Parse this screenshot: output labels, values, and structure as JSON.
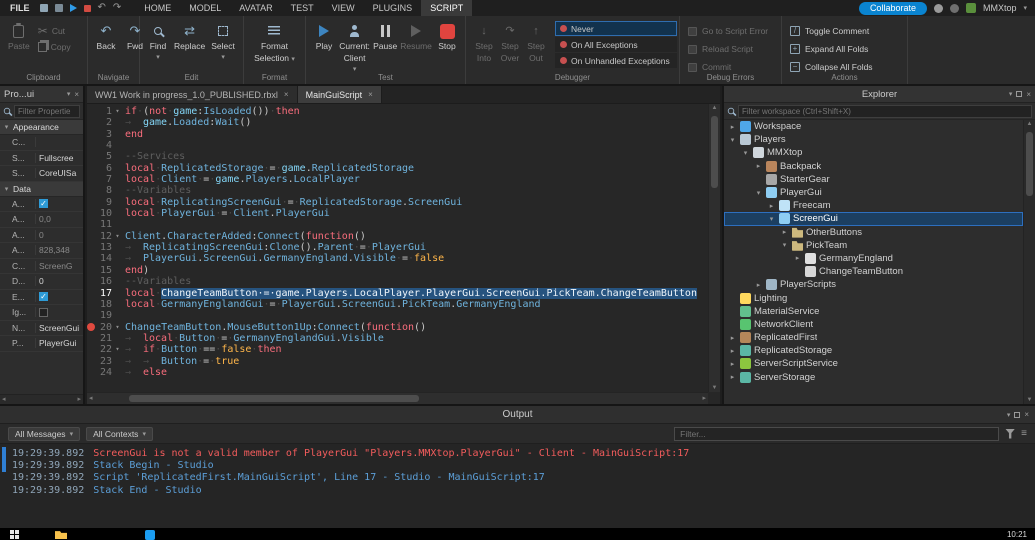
{
  "menubar": {
    "file_label": "FILE",
    "tabs": [
      "HOME",
      "MODEL",
      "AVATAR",
      "TEST",
      "VIEW",
      "PLUGINS",
      "SCRIPT"
    ],
    "active_tab": "SCRIPT",
    "collaborate_label": "Collaborate",
    "username": "MMXtop"
  },
  "ribbon": {
    "clipboard": {
      "label": "Clipboard",
      "paste": "Paste",
      "cut": "Cut",
      "copy": "Copy"
    },
    "navigate": {
      "label": "Navigate",
      "back": "Back",
      "fwd": "Fwd"
    },
    "edit": {
      "label": "Edit",
      "find": "Find",
      "replace": "Replace",
      "select": "Select"
    },
    "format": {
      "label": "Format",
      "line1": "Format",
      "line2": "Selection"
    },
    "test": {
      "label": "Test",
      "play": "Play",
      "current1": "Current:",
      "current2": "Client",
      "pause": "Pause",
      "resume": "Resume",
      "stop": "Stop"
    },
    "debugger": {
      "label": "Debugger",
      "steps": [
        [
          "Step",
          "Into"
        ],
        [
          "Step",
          "Over"
        ],
        [
          "Step",
          "Out"
        ]
      ],
      "step_icons": [
        "↓",
        "↷",
        "↑"
      ],
      "exceptions": [
        "Never",
        "On All Exceptions",
        "On Unhandled Exceptions"
      ],
      "selected_exception": "Never"
    },
    "debug_errors": {
      "label": "Debug Errors",
      "items": [
        "Go to Script Error",
        "Reload Script",
        "Commit"
      ]
    },
    "actions": {
      "label": "Actions",
      "items": [
        "Toggle Comment",
        "Expand All Folds",
        "Collapse All Folds"
      ],
      "icons": [
        "/",
        "+",
        "−"
      ]
    }
  },
  "properties": {
    "title": "Pro...ui",
    "filter_placeholder": "Filter Propertie",
    "sections": [
      {
        "name": "Appearance",
        "rows": [
          {
            "key": "C...",
            "value": ""
          },
          {
            "key": "S...",
            "value": "Fullscree"
          },
          {
            "key": "S...",
            "value": "CoreUISa"
          }
        ]
      },
      {
        "name": "Data",
        "rows": [
          {
            "key": "A...",
            "checkbox": true,
            "checked": true
          },
          {
            "key": "A...",
            "value": "0,0",
            "dim": true
          },
          {
            "key": "A...",
            "value": "0",
            "dim": true
          },
          {
            "key": "A...",
            "value": "828,348",
            "dim": true
          },
          {
            "key": "C...",
            "value": "ScreenG",
            "dim": true
          },
          {
            "key": "D...",
            "value": "0"
          },
          {
            "key": "E...",
            "checkbox": true,
            "checked": true
          },
          {
            "key": "Ig...",
            "checkbox": true,
            "checked": false
          },
          {
            "key": "N...",
            "value": "ScreenGui"
          },
          {
            "key": "P...",
            "value": "PlayerGui"
          }
        ]
      }
    ]
  },
  "editor": {
    "tabs": [
      {
        "label": "WW1 Work in progress_1.0_PUBLISHED.rbxl",
        "active": false
      },
      {
        "label": "MainGuiScript",
        "active": true
      }
    ],
    "lines": [
      {
        "n": 1,
        "fold": true,
        "tk": [
          [
            "k",
            "if"
          ],
          [
            "w",
            "·"
          ],
          [
            "o",
            "("
          ],
          [
            "k",
            "not"
          ],
          [
            "w",
            "·"
          ],
          [
            "g",
            "game"
          ],
          [
            "o",
            ":"
          ],
          [
            "v",
            "IsLoaded"
          ],
          [
            "o",
            "())"
          ],
          [
            "w",
            "·"
          ],
          [
            "k",
            "then"
          ]
        ]
      },
      {
        "n": 2,
        "tk": [
          [
            "t",
            "→"
          ],
          [
            "g",
            "game"
          ],
          [
            "o",
            "."
          ],
          [
            "v",
            "Loaded"
          ],
          [
            "o",
            ":"
          ],
          [
            "v",
            "Wait"
          ],
          [
            "o",
            "()"
          ]
        ]
      },
      {
        "n": 3,
        "tk": [
          [
            "k",
            "end"
          ]
        ]
      },
      {
        "n": 4,
        "tk": []
      },
      {
        "n": 5,
        "tk": [
          [
            "c",
            "--Services"
          ]
        ]
      },
      {
        "n": 6,
        "tk": [
          [
            "k",
            "local"
          ],
          [
            "w",
            "·"
          ],
          [
            "v",
            "ReplicatedStorage"
          ],
          [
            "w",
            "·"
          ],
          [
            "o",
            "="
          ],
          [
            "w",
            "·"
          ],
          [
            "g",
            "game"
          ],
          [
            "o",
            "."
          ],
          [
            "v",
            "ReplicatedStorage"
          ]
        ]
      },
      {
        "n": 7,
        "tk": [
          [
            "k",
            "local"
          ],
          [
            "w",
            "·"
          ],
          [
            "v",
            "Client"
          ],
          [
            "w",
            "·"
          ],
          [
            "o",
            "="
          ],
          [
            "w",
            "·"
          ],
          [
            "g",
            "game"
          ],
          [
            "o",
            "."
          ],
          [
            "v",
            "Players"
          ],
          [
            "o",
            "."
          ],
          [
            "v",
            "LocalPlayer"
          ]
        ]
      },
      {
        "n": 8,
        "tk": [
          [
            "c",
            "--Variables"
          ]
        ]
      },
      {
        "n": 9,
        "tk": [
          [
            "k",
            "local"
          ],
          [
            "w",
            "·"
          ],
          [
            "v",
            "ReplicatingScreenGui"
          ],
          [
            "w",
            "·"
          ],
          [
            "o",
            "="
          ],
          [
            "w",
            "·"
          ],
          [
            "v",
            "ReplicatedStorage"
          ],
          [
            "o",
            "."
          ],
          [
            "v",
            "ScreenGui"
          ]
        ]
      },
      {
        "n": 10,
        "tk": [
          [
            "k",
            "local"
          ],
          [
            "w",
            "·"
          ],
          [
            "v",
            "PlayerGui"
          ],
          [
            "w",
            "·"
          ],
          [
            "o",
            "="
          ],
          [
            "w",
            "·"
          ],
          [
            "v",
            "Client"
          ],
          [
            "o",
            "."
          ],
          [
            "v",
            "PlayerGui"
          ]
        ]
      },
      {
        "n": 11,
        "tk": []
      },
      {
        "n": 12,
        "fold": true,
        "tk": [
          [
            "v",
            "Client"
          ],
          [
            "o",
            "."
          ],
          [
            "v",
            "CharacterAdded"
          ],
          [
            "o",
            ":"
          ],
          [
            "v",
            "Connect"
          ],
          [
            "o",
            "("
          ],
          [
            "k",
            "function"
          ],
          [
            "o",
            "()"
          ]
        ]
      },
      {
        "n": 13,
        "tk": [
          [
            "t",
            "→"
          ],
          [
            "v",
            "ReplicatingScreenGui"
          ],
          [
            "o",
            ":"
          ],
          [
            "v",
            "Clone"
          ],
          [
            "o",
            "()."
          ],
          [
            "v",
            "Parent"
          ],
          [
            "w",
            "·"
          ],
          [
            "o",
            "="
          ],
          [
            "w",
            "·"
          ],
          [
            "v",
            "PlayerGui"
          ]
        ]
      },
      {
        "n": 14,
        "tk": [
          [
            "t",
            "→"
          ],
          [
            "v",
            "PlayerGui"
          ],
          [
            "o",
            "."
          ],
          [
            "v",
            "ScreenGui"
          ],
          [
            "o",
            "."
          ],
          [
            "v",
            "GermanyEngland"
          ],
          [
            "o",
            "."
          ],
          [
            "v",
            "Visible"
          ],
          [
            "w",
            "·"
          ],
          [
            "o",
            "="
          ],
          [
            "w",
            "·"
          ],
          [
            "b",
            "false"
          ]
        ]
      },
      {
        "n": 15,
        "tk": [
          [
            "k",
            "end"
          ],
          [
            "o",
            ")"
          ]
        ]
      },
      {
        "n": 16,
        "tk": [
          [
            "c",
            "--Variables"
          ]
        ]
      },
      {
        "n": 17,
        "cur": true,
        "tk": [
          [
            "k",
            "local"
          ],
          [
            "w",
            "·"
          ],
          [
            "s",
            "ChangeTeamButton·=·game.Players.LocalPlayer.PlayerGui.ScreenGui.PickTeam.ChangeTeamButton"
          ]
        ]
      },
      {
        "n": 18,
        "tk": [
          [
            "k",
            "local"
          ],
          [
            "w",
            "·"
          ],
          [
            "v",
            "GermanyEnglandGui"
          ],
          [
            "w",
            "·"
          ],
          [
            "o",
            "="
          ],
          [
            "w",
            "·"
          ],
          [
            "v",
            "PlayerGui"
          ],
          [
            "o",
            "."
          ],
          [
            "v",
            "ScreenGui"
          ],
          [
            "o",
            "."
          ],
          [
            "v",
            "PickTeam"
          ],
          [
            "o",
            "."
          ],
          [
            "v",
            "GermanyEngland"
          ]
        ]
      },
      {
        "n": 19,
        "tk": []
      },
      {
        "n": 20,
        "fold": true,
        "bp": true,
        "tk": [
          [
            "v",
            "ChangeTeamButton"
          ],
          [
            "o",
            "."
          ],
          [
            "v",
            "MouseButton1Up"
          ],
          [
            "o",
            ":"
          ],
          [
            "v",
            "Connect"
          ],
          [
            "o",
            "("
          ],
          [
            "k",
            "function"
          ],
          [
            "o",
            "()"
          ]
        ]
      },
      {
        "n": 21,
        "tk": [
          [
            "t",
            "→"
          ],
          [
            "k",
            "local"
          ],
          [
            "w",
            "·"
          ],
          [
            "v",
            "Button"
          ],
          [
            "w",
            "·"
          ],
          [
            "o",
            "="
          ],
          [
            "w",
            "·"
          ],
          [
            "v",
            "GermanyEnglandGui"
          ],
          [
            "o",
            "."
          ],
          [
            "v",
            "Visible"
          ]
        ]
      },
      {
        "n": 22,
        "fold": true,
        "tk": [
          [
            "t",
            "→"
          ],
          [
            "k",
            "if"
          ],
          [
            "w",
            "·"
          ],
          [
            "v",
            "Button"
          ],
          [
            "w",
            "·"
          ],
          [
            "o",
            "=="
          ],
          [
            "w",
            "·"
          ],
          [
            "b",
            "false"
          ],
          [
            "w",
            "·"
          ],
          [
            "k",
            "then"
          ]
        ]
      },
      {
        "n": 23,
        "tk": [
          [
            "t",
            "→"
          ],
          [
            "t",
            "→"
          ],
          [
            "v",
            "Button"
          ],
          [
            "w",
            "·"
          ],
          [
            "o",
            "="
          ],
          [
            "w",
            "·"
          ],
          [
            "b",
            "true"
          ]
        ]
      },
      {
        "n": 24,
        "tk": [
          [
            "t",
            "→"
          ],
          [
            "k",
            "else"
          ]
        ]
      }
    ]
  },
  "explorer": {
    "title": "Explorer",
    "filter_placeholder": "Filter workspace (Ctrl+Shift+X)",
    "tree": [
      {
        "d": 0,
        "a": "r",
        "icon": "workspace-icon",
        "color": "#4fa7e8",
        "label": "Workspace"
      },
      {
        "d": 0,
        "a": "v",
        "icon": "players-icon",
        "color": "#b9c8d4",
        "label": "Players"
      },
      {
        "d": 1,
        "a": "v",
        "icon": "player-icon",
        "color": "#cfd6dc",
        "label": "MMXtop"
      },
      {
        "d": 2,
        "a": "r",
        "icon": "backpack-icon",
        "color": "#b9855c",
        "label": "Backpack"
      },
      {
        "d": 2,
        "a": "",
        "icon": "startergear-icon",
        "color": "#a7a7a7",
        "label": "StarterGear"
      },
      {
        "d": 2,
        "a": "v",
        "icon": "playergui-icon",
        "color": "#8ecdf2",
        "label": "PlayerGui"
      },
      {
        "d": 3,
        "a": "r",
        "icon": "script-icon",
        "color": "#bfe3f7",
        "label": "Freecam"
      },
      {
        "d": 3,
        "a": "v",
        "icon": "screengui-icon",
        "color": "#8ecdf2",
        "label": "ScreenGui",
        "selected": true
      },
      {
        "d": 4,
        "a": "r",
        "icon": "folder-icon",
        "color": "#cdb97e",
        "label": "OtherButtons",
        "folder": true
      },
      {
        "d": 4,
        "a": "v",
        "icon": "folder-icon",
        "color": "#cdb97e",
        "label": "PickTeam",
        "folder": true
      },
      {
        "d": 5,
        "a": "r",
        "icon": "frame-icon",
        "color": "#e0e0e0",
        "label": "GermanyEngland"
      },
      {
        "d": 5,
        "a": "",
        "icon": "textbutton-icon",
        "color": "#d7d7d7",
        "label": "ChangeTeamButton"
      },
      {
        "d": 2,
        "a": "r",
        "icon": "playerscripts-icon",
        "color": "#9fb6c6",
        "label": "PlayerScripts"
      },
      {
        "d": 0,
        "a": "",
        "icon": "lighting-icon",
        "color": "#ffd95e",
        "label": "Lighting"
      },
      {
        "d": 0,
        "a": "",
        "icon": "materialservice-icon",
        "color": "#62bf8d",
        "label": "MaterialService"
      },
      {
        "d": 0,
        "a": "",
        "icon": "networkclient-icon",
        "color": "#58c470",
        "label": "NetworkClient"
      },
      {
        "d": 0,
        "a": "r",
        "icon": "replicatedfirst-icon",
        "color": "#b5875a",
        "label": "ReplicatedFirst"
      },
      {
        "d": 0,
        "a": "r",
        "icon": "replicatedstorage-icon",
        "color": "#5bb7a5",
        "label": "ReplicatedStorage"
      },
      {
        "d": 0,
        "a": "r",
        "icon": "serverscriptservice-icon",
        "color": "#8cc63f",
        "label": "ServerScriptService"
      },
      {
        "d": 0,
        "a": "r",
        "icon": "serverstorage-icon",
        "color": "#5bb7a5",
        "label": "ServerStorage"
      }
    ]
  },
  "output": {
    "title": "Output",
    "messages_filter": "All Messages",
    "contexts_filter": "All Contexts",
    "filter_placeholder": "Filter...",
    "lines": [
      {
        "ts": "19:29:39.892",
        "type": "error",
        "msg": "ScreenGui is not a valid member of PlayerGui \"Players.MMXtop.PlayerGui\"  -  Client - MainGuiScript:17"
      },
      {
        "ts": "19:29:39.892",
        "type": "info",
        "msg": "Stack Begin  -  Studio"
      },
      {
        "ts": "19:29:39.892",
        "type": "info",
        "msg": "Script 'ReplicatedFirst.MainGuiScript', Line 17  -  Studio - MainGuiScript:17"
      },
      {
        "ts": "19:29:39.892",
        "type": "info",
        "msg": "Stack End  -  Studio"
      }
    ]
  },
  "taskbar": {
    "clock": "10:21"
  }
}
